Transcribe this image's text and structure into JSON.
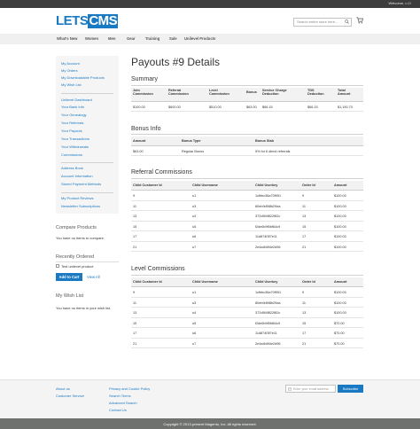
{
  "header": {
    "welcome": "Welcome, u 1!",
    "logo_lets": "LETS",
    "logo_cms": "CMS",
    "search_placeholder": "Search entire store here...",
    "cart_icon": "cart-icon",
    "search_icon": "search-icon"
  },
  "nav": [
    "What's New",
    "Women",
    "Men",
    "Gear",
    "Training",
    "Sale",
    "Unilevel Products"
  ],
  "sidebar": {
    "group1": [
      "My Account",
      "My Orders",
      "My Downloadable Products",
      "My Wish List"
    ],
    "group2": [
      "Unilevel Dashboard",
      "Your Bank Info",
      "Your Genealogy",
      "Your Referrals",
      "Your Payouts",
      "Your Transactions",
      "Your Withdrawals",
      "Commissions"
    ],
    "group3": [
      "Address Book",
      "Account Information",
      "Stored Payment Methods"
    ],
    "group4": [
      "My Product Reviews",
      "Newsletter Subscriptions"
    ]
  },
  "compare": {
    "title": "Compare Products",
    "text": "You have no items to compare."
  },
  "recent": {
    "title": "Recently Ordered",
    "item": "Test unilevel product",
    "add_to_cart": "Add to Cart",
    "view_all": "View All"
  },
  "wishlist": {
    "title": "My Wish List",
    "text": "You have no items in your wish list."
  },
  "main": {
    "title": "Payouts #9 Details",
    "summary": {
      "title": "Summary",
      "headers": [
        "Join\nCommission",
        "Referral\nCommission",
        "Level\nCommission",
        "Bonus",
        "Service Charge\nDeduction",
        "TDS\nDeduction",
        "Total\nAmount"
      ],
      "values": [
        "$100.00",
        "$600.00",
        "$510.00",
        "$63.00",
        "$66.15",
        "$66.15",
        "$1,190.70"
      ]
    },
    "bonus": {
      "title": "Bonus Info",
      "headers": [
        "Amount",
        "Bonus Type",
        "Bonus Slab"
      ],
      "rows": [
        [
          "$63.00",
          "Regular Bonus",
          "5% for 6 direct referrals"
        ]
      ]
    },
    "referral": {
      "title": "Referral Commissions",
      "headers": [
        "Child Customer Id",
        "Child Username",
        "Child Userkey",
        "Order Id",
        "Amount"
      ],
      "rows": [
        [
          "9",
          "u1",
          "1cfbbc36a70f951",
          "9",
          "$100.00"
        ],
        [
          "11",
          "u3",
          "80eb9d5f8b29da",
          "11",
          "$100.00"
        ],
        [
          "13",
          "u4",
          "372d5f4f822f62c",
          "13",
          "$100.00"
        ],
        [
          "15",
          "u5",
          "f2de6b9f0bf64c9",
          "15",
          "$100.00"
        ],
        [
          "17",
          "u6",
          "11d874f3f7e11",
          "17",
          "$100.00"
        ],
        [
          "21",
          "u7",
          "2e4a4b6f4e2d96",
          "21",
          "$100.00"
        ]
      ]
    },
    "level": {
      "title": "Level Commissions",
      "headers": [
        "Child Customer Id",
        "Child Username",
        "Child Userkey",
        "Order Id",
        "Amount"
      ],
      "rows": [
        [
          "9",
          "u1",
          "1cfbbc36a70f951",
          "9",
          "$100.00"
        ],
        [
          "11",
          "u3",
          "80eb9d5f8b29da",
          "11",
          "$100.00"
        ],
        [
          "13",
          "u4",
          "372d5f4f822f62c",
          "13",
          "$100.00"
        ],
        [
          "15",
          "u5",
          "f2de6b9f0bf64c9",
          "15",
          "$70.00"
        ],
        [
          "17",
          "u6",
          "11d874f3f7e11",
          "17",
          "$70.00"
        ],
        [
          "21",
          "u7",
          "2e4a4b6f4e2d96",
          "21",
          "$70.00"
        ]
      ]
    }
  },
  "footer": {
    "col1": [
      "About us",
      "Customer Service"
    ],
    "col2": [
      "Privacy and Cookie Policy",
      "Search Terms",
      "Advanced Search",
      "Contact Us"
    ],
    "newsletter_placeholder": "Enter your email address",
    "subscribe": "Subscribe",
    "copyright": "Copyright © 2013-present Magento, Inc. All rights reserved."
  },
  "colors": {
    "accent": "#1979c3",
    "topbar": "#3d3d3d",
    "copyright_bar": "#6e716e"
  }
}
